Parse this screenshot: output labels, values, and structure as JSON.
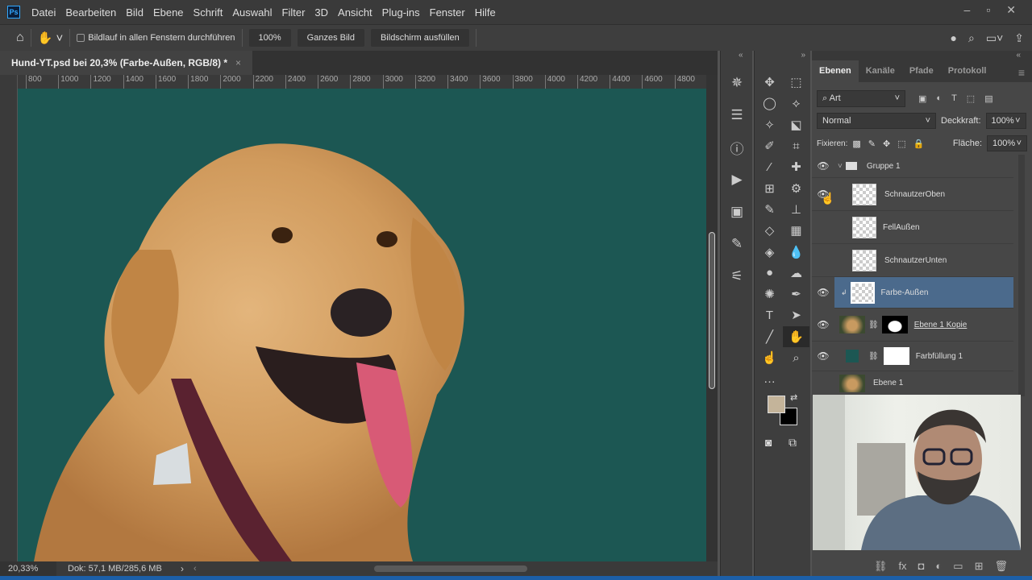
{
  "app": {
    "logo": "Ps"
  },
  "menu": [
    "Datei",
    "Bearbeiten",
    "Bild",
    "Ebene",
    "Schrift",
    "Auswahl",
    "Filter",
    "3D",
    "Ansicht",
    "Plug-ins",
    "Fenster",
    "Hilfe"
  ],
  "options": {
    "scroll_all": "Bildlauf in allen Fenstern durchführen",
    "zoom100": "100%",
    "fit": "Ganzes Bild",
    "fill": "Bildschirm ausfüllen"
  },
  "document": {
    "tab_title": "Hund-YT.psd bei 20,3% (Farbe-Außen, RGB/8) *",
    "close": "×"
  },
  "ruler": [
    "800",
    "1000",
    "1200",
    "1400",
    "1600",
    "1800",
    "2000",
    "2200",
    "2400",
    "2600",
    "2800",
    "3000",
    "3200",
    "3400",
    "3600",
    "3800",
    "4000",
    "4200",
    "4400",
    "4600",
    "4800"
  ],
  "status": {
    "zoom": "20,33%",
    "doc": "Dok: 57,1 MB/285,6 MB"
  },
  "colors": {
    "canvas": "#1c5753",
    "foreground": "#c4b49a",
    "background": "#000000",
    "selected_layer": "#4b6a8c"
  },
  "layers_panel": {
    "tabs": [
      "Ebenen",
      "Kanäle",
      "Pfade",
      "Protokoll"
    ],
    "filter": "Art",
    "blend_mode": "Normal",
    "opacity_label": "Deckkraft:",
    "opacity": "100%",
    "lock_label": "Fixieren:",
    "fill_label": "Fläche:",
    "fill": "100%",
    "layers": [
      {
        "name": "Gruppe 1",
        "visible": true
      },
      {
        "name": "SchnautzerOben",
        "visible": true
      },
      {
        "name": "FellAußen",
        "visible": false
      },
      {
        "name": "SchnautzerUnten",
        "visible": false
      },
      {
        "name": "Farbe-Außen",
        "visible": true,
        "selected": true
      },
      {
        "name": "Ebene 1 Kopie",
        "visible": true
      },
      {
        "name": "Farbfüllung 1",
        "visible": true
      },
      {
        "name": "Ebene 1",
        "visible": false
      }
    ]
  }
}
